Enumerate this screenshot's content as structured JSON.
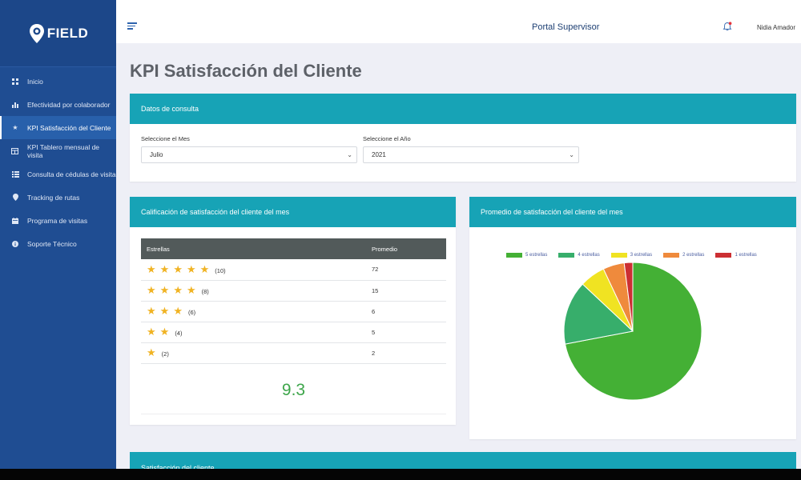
{
  "brand": {
    "logo_text": "FIELD"
  },
  "sidebar": {
    "items": [
      {
        "label": "Inicio",
        "icon": "dashboard-icon"
      },
      {
        "label": "Efectividad por colaborador",
        "icon": "bar-chart-icon"
      },
      {
        "label": "KPI Satisfacción del Cliente",
        "icon": "star-icon",
        "active": true
      },
      {
        "label": "KPI Tablero mensual de visita",
        "icon": "table-icon"
      },
      {
        "label": "Consulta de cédulas de visita",
        "icon": "list-icon"
      },
      {
        "label": "Tracking de rutas",
        "icon": "map-pin-icon"
      },
      {
        "label": "Programa de visitas",
        "icon": "calendar-icon"
      },
      {
        "label": "Soporte Técnico",
        "icon": "info-icon"
      }
    ]
  },
  "header": {
    "portal_title": "Portal Supervisor",
    "user_name": "Nidia Amador"
  },
  "page": {
    "title": "KPI Satisfacción del Cliente"
  },
  "query_card": {
    "title": "Datos de consulta",
    "month_label": "Seleccione el Mes",
    "month_value": "Julio",
    "year_label": "Seleccione el Año",
    "year_value": "2021"
  },
  "rating_card": {
    "title": "Calificación de satisfacción del cliente del mes",
    "col_stars": "Estrellas",
    "col_avg": "Promedio",
    "rows": [
      {
        "stars": 5,
        "count": "(10)",
        "avg": "72"
      },
      {
        "stars": 4,
        "count": "(8)",
        "avg": "15"
      },
      {
        "stars": 3,
        "count": "(6)",
        "avg": "6"
      },
      {
        "stars": 2,
        "count": "(4)",
        "avg": "5"
      },
      {
        "stars": 1,
        "count": "(2)",
        "avg": "2"
      }
    ],
    "average": "9.3"
  },
  "chart_card": {
    "title": "Promedio de satisfacción del cliente del mes"
  },
  "chart_data": {
    "type": "pie",
    "title": "",
    "legend_position": "top",
    "labels": [
      "5 estrellas",
      "4 estrellas",
      "3 estrellas",
      "2 estrellas",
      "1 estrellas"
    ],
    "values": [
      72,
      15,
      6,
      5,
      2
    ],
    "colors": [
      "#44b035",
      "#37ae6b",
      "#f0e322",
      "#ef8a3c",
      "#cc2f33"
    ]
  },
  "bottom_card": {
    "title": "Satisfacción del cliente"
  }
}
